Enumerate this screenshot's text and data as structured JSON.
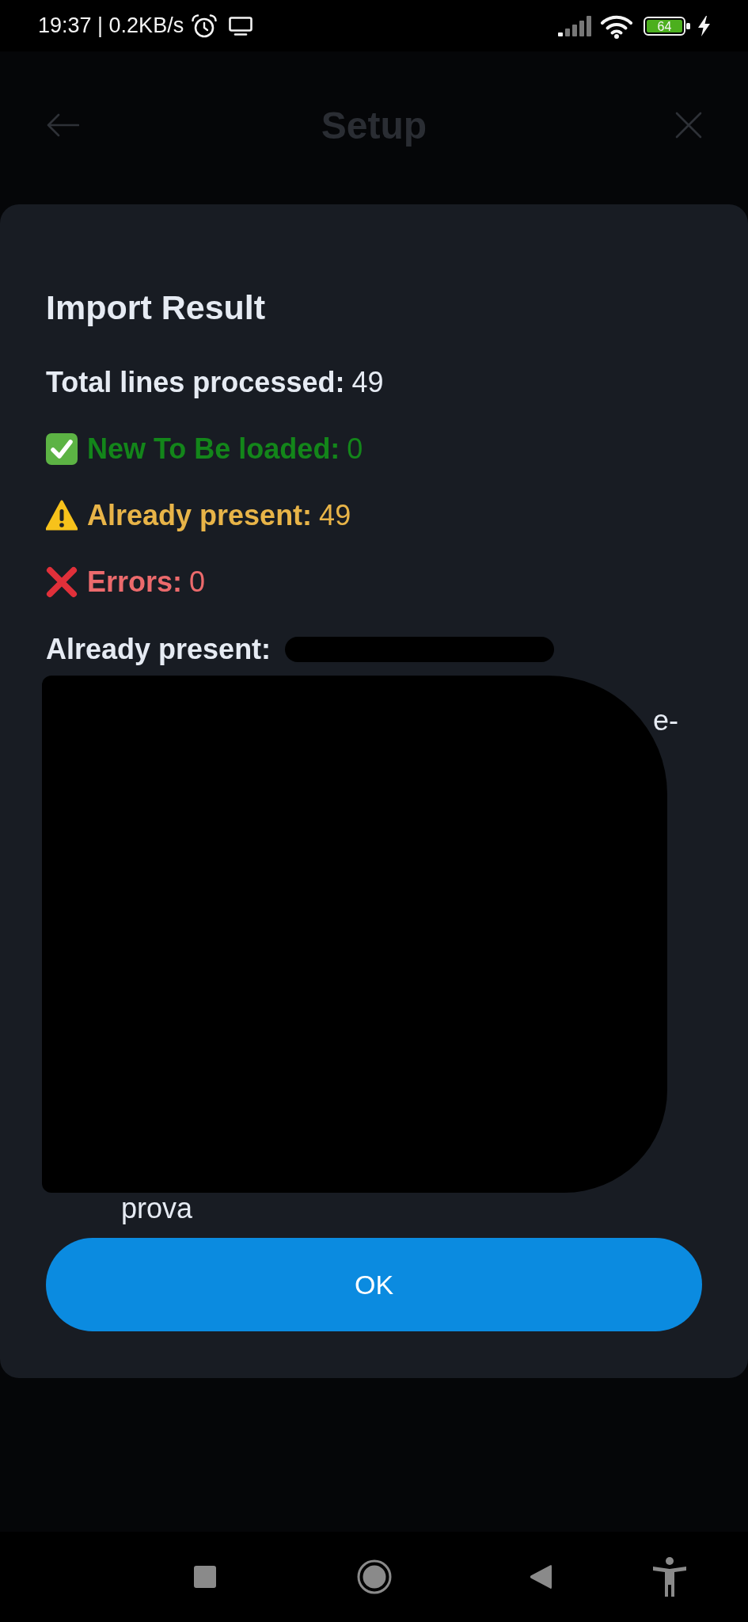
{
  "status_bar": {
    "time": "19:37 | 0.2KB/s",
    "battery": "64",
    "charging": true
  },
  "header": {
    "title": "Setup"
  },
  "dialog": {
    "title": "Import Result",
    "stats": [
      {
        "kind": "total",
        "label": "Total lines processed:",
        "value": "49",
        "color": "#e6ebf3"
      },
      {
        "kind": "new",
        "label": "New To Be loaded:",
        "value": "0",
        "color": "#13861a"
      },
      {
        "kind": "present",
        "label": "Already present:",
        "value": "49",
        "color": "#e8b448"
      },
      {
        "kind": "error",
        "label": "Errors:",
        "value": "0",
        "color": "#ec6a6c"
      }
    ],
    "detail": {
      "label": "Already present:",
      "redacted": true,
      "line_end_fragment": "e-",
      "last_line_fragment": "prova"
    },
    "button": "OK"
  }
}
